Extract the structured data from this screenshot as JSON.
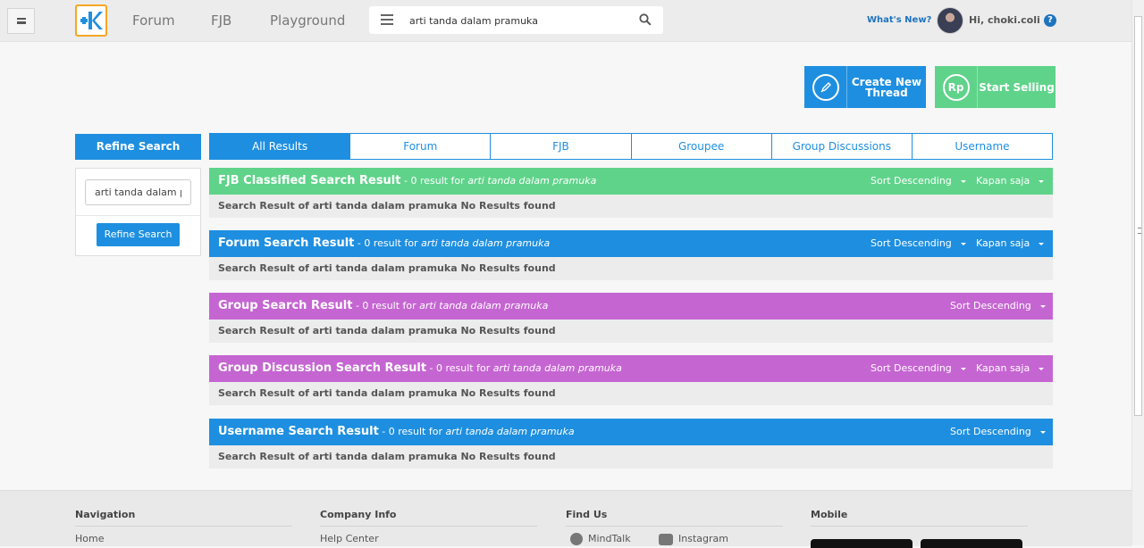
{
  "header": {
    "nav": [
      {
        "label": "Forum"
      },
      {
        "label": "FJB"
      },
      {
        "label": "Playground"
      }
    ],
    "search": {
      "value": "arti tanda dalam pramuka"
    },
    "whats_new": "What's New?",
    "greeting": "Hi, choki.coli",
    "help": "?"
  },
  "actions": {
    "create_thread": "Create New Thread",
    "start_selling": "Start Selling",
    "rp_icon_text": "Rp"
  },
  "refine": {
    "title": "Refine Search",
    "input_value": "arti tanda dalam pramuka",
    "button": "Refine Search"
  },
  "tabs": [
    {
      "label": "All Results",
      "active": true
    },
    {
      "label": "Forum"
    },
    {
      "label": "FJB"
    },
    {
      "label": "Groupee"
    },
    {
      "label": "Group Discussions"
    },
    {
      "label": "Username"
    }
  ],
  "sections": [
    {
      "title": "FJB Classified Search Result",
      "meta_prefix": " - 0 result for ",
      "query": "arti tanda dalam pramuka",
      "sort": "Sort Descending",
      "time": "Kapan saja",
      "message": "Search Result of arti tanda dalam pramuka No Results found",
      "color": "#5fd38a"
    },
    {
      "title": "Forum Search Result",
      "meta_prefix": " - 0 result for ",
      "query": "arti tanda dalam pramuka",
      "sort": "Sort Descending",
      "time": "Kapan saja",
      "message": "Search Result of arti tanda dalam pramuka No Results found",
      "color": "#1e8fe0"
    },
    {
      "title": "Group Search Result",
      "meta_prefix": " - 0 result for ",
      "query": "arti tanda dalam pramuka",
      "sort": "Sort Descending",
      "message": "Search Result of arti tanda dalam pramuka No Results found",
      "color": "#c565d2"
    },
    {
      "title": "Group Discussion Search Result",
      "meta_prefix": " - 0 result for ",
      "query": "arti tanda dalam pramuka",
      "sort": "Sort Descending",
      "time": "Kapan saja",
      "message": "Search Result of arti tanda dalam pramuka No Results found",
      "color": "#c565d2"
    },
    {
      "title": "Username Search Result",
      "meta_prefix": " - 0 result for ",
      "query": "arti tanda dalam pramuka",
      "sort": "Sort Descending",
      "message": "Search Result of arti tanda dalam pramuka No Results found",
      "color": "#1e8fe0"
    }
  ],
  "footer": {
    "navigation": {
      "title": "Navigation",
      "first_link": "Home"
    },
    "company": {
      "title": "Company Info",
      "first_link": "Help Center"
    },
    "find_us": {
      "title": "Find Us",
      "links": [
        "MindTalk",
        "Instagram"
      ]
    },
    "mobile": {
      "title": "Mobile"
    }
  },
  "colors": {
    "brand_blue": "#1e8fe0",
    "brand_green": "#5fd38a",
    "group_purple": "#c565d2",
    "logo_orange": "#f5a623"
  }
}
